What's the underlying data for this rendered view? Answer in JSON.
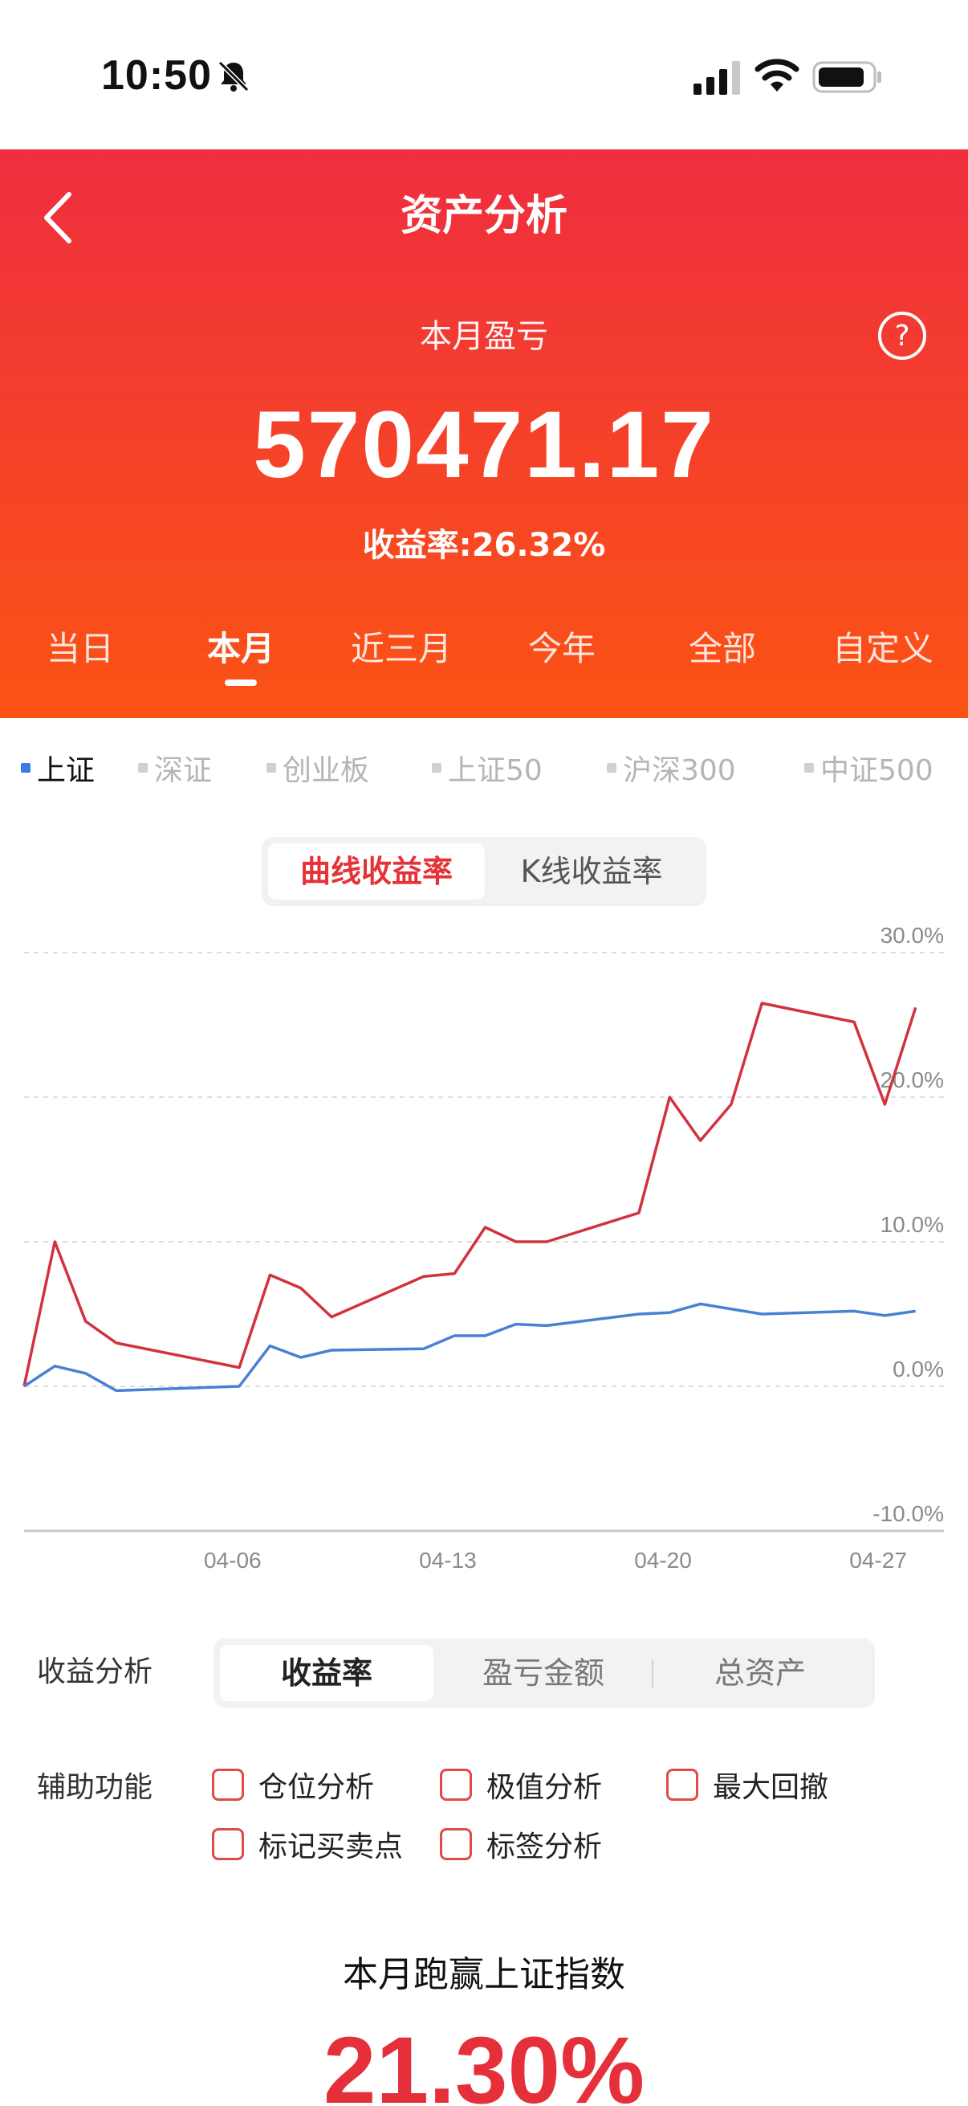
{
  "status": {
    "time": "10:50"
  },
  "header": {
    "title": "资产分析",
    "month_label": "本月盈亏",
    "pnl_value": "570471.17",
    "yield_label": "收益率:",
    "yield_value": "26.32%"
  },
  "period_tabs": [
    "当日",
    "本月",
    "近三月",
    "今年",
    "全部",
    "自定义"
  ],
  "active_period": "本月",
  "indices": [
    "上证",
    "深证",
    "创业板",
    "上证50",
    "沪深300",
    "中证500"
  ],
  "active_index": "上证",
  "chart_modes": [
    "曲线收益率",
    "K线收益率"
  ],
  "chart_data": {
    "type": "line",
    "y_ticks": [
      "30.0%",
      "20.0%",
      "10.0%",
      "0.0%",
      "-10.0%"
    ],
    "ylim": [
      -10,
      30
    ],
    "x_ticks": [
      "04-06",
      "04-13",
      "04-20",
      "04-27"
    ],
    "x_tick_days": [
      6,
      13,
      20,
      27
    ],
    "series": [
      {
        "color": "#d23240",
        "points": [
          [
            0,
            0
          ],
          [
            1,
            10
          ],
          [
            2,
            4.5
          ],
          [
            3,
            3
          ],
          [
            7,
            1.3
          ],
          [
            8,
            7.7
          ],
          [
            9,
            6.8
          ],
          [
            10,
            4.8
          ],
          [
            13,
            7.6
          ],
          [
            14,
            7.8
          ],
          [
            15,
            11
          ],
          [
            16,
            10
          ],
          [
            17,
            10
          ],
          [
            20,
            12
          ],
          [
            21,
            20
          ],
          [
            22,
            17
          ],
          [
            23,
            19.5
          ],
          [
            24,
            26.5
          ],
          [
            27,
            25.2
          ],
          [
            28,
            19.5
          ],
          [
            29,
            26.2
          ]
        ]
      },
      {
        "color": "#4a80d4",
        "points": [
          [
            0,
            0
          ],
          [
            1,
            1.4
          ],
          [
            2,
            0.9
          ],
          [
            3,
            -0.3
          ],
          [
            7,
            0
          ],
          [
            8,
            2.8
          ],
          [
            9,
            2
          ],
          [
            10,
            2.5
          ],
          [
            13,
            2.6
          ],
          [
            14,
            3.5
          ],
          [
            15,
            3.5
          ],
          [
            16,
            4.3
          ],
          [
            17,
            4.2
          ],
          [
            20,
            5
          ],
          [
            21,
            5.1
          ],
          [
            22,
            5.7
          ],
          [
            24,
            5
          ],
          [
            27,
            5.2
          ],
          [
            28,
            4.9
          ],
          [
            29,
            5.2
          ]
        ]
      }
    ],
    "grid": true
  },
  "analysis": {
    "label": "收益分析",
    "options": [
      "收益率",
      "盈亏金额",
      "总资产"
    ],
    "active": "收益率"
  },
  "aux": {
    "label": "辅助功能",
    "items": [
      "仓位分析",
      "极值分析",
      "最大回撤",
      "标记买卖点",
      "标签分析"
    ]
  },
  "summary": {
    "beat_label": "本月跑赢上证指数",
    "beat_value": "21.30%"
  }
}
